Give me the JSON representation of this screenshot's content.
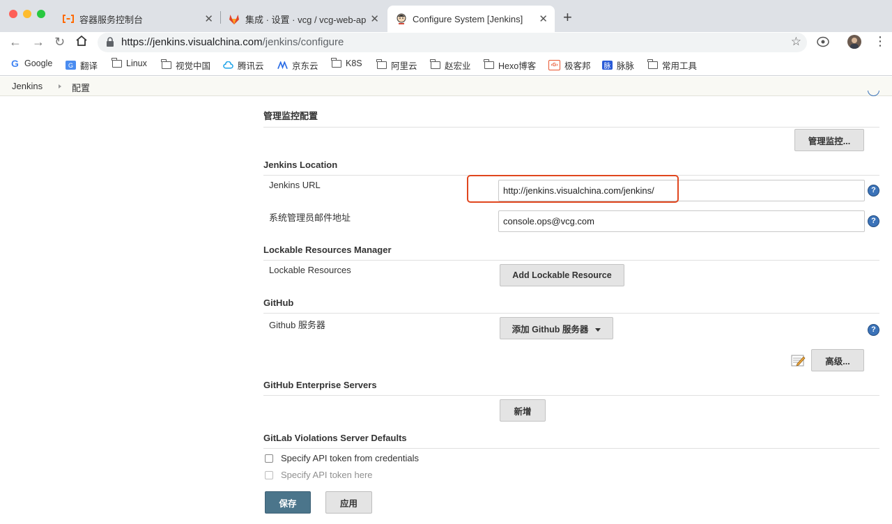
{
  "browser": {
    "tabs": [
      {
        "title": "容器服务控制台",
        "icon": "aliyun-icon"
      },
      {
        "title": "集成 · 设置 · vcg / vcg-web-ap",
        "icon": "gitlab-icon"
      },
      {
        "title": "Configure System [Jenkins]",
        "icon": "jenkins-icon",
        "active": true
      }
    ],
    "url_host": "https://jenkins.visualchina.com",
    "url_path": "/jenkins/configure",
    "bookmarks": [
      {
        "label": "Google",
        "icon": "google-icon"
      },
      {
        "label": "翻译",
        "icon": "translate-icon"
      },
      {
        "label": "Linux",
        "icon": "folder-icon"
      },
      {
        "label": "视觉中国",
        "icon": "folder-icon"
      },
      {
        "label": "腾讯云",
        "icon": "tencent-cloud-icon"
      },
      {
        "label": "京东云",
        "icon": "jd-cloud-icon"
      },
      {
        "label": "K8S",
        "icon": "folder-icon"
      },
      {
        "label": "阿里云",
        "icon": "folder-icon"
      },
      {
        "label": "赵宏业",
        "icon": "folder-icon"
      },
      {
        "label": "Hexo博客",
        "icon": "folder-icon"
      },
      {
        "label": "极客邦",
        "icon": "geekbang-icon"
      },
      {
        "label": "脉脉",
        "icon": "maimai-icon"
      },
      {
        "label": "常用工具",
        "icon": "folder-icon"
      }
    ]
  },
  "breadcrumb": {
    "root": "Jenkins",
    "current": "配置"
  },
  "sections": {
    "monitor": {
      "title": "管理监控配置",
      "button": "管理监控..."
    },
    "location": {
      "title": "Jenkins Location",
      "url_label": "Jenkins URL",
      "url_value": "http://jenkins.visualchina.com/jenkins/",
      "email_label": "系统管理员邮件地址",
      "email_value": "console.ops@vcg.com"
    },
    "lockable": {
      "title": "Lockable Resources Manager",
      "label": "Lockable Resources",
      "button": "Add Lockable Resource"
    },
    "github": {
      "title": "GitHub",
      "label": "Github 服务器",
      "button": "添加 Github 服务器",
      "advanced": "高级..."
    },
    "github_enterprise": {
      "title": "GitHub Enterprise Servers",
      "button": "新增"
    },
    "gitlab_violations": {
      "title": "GitLab Violations Server Defaults",
      "check1": "Specify API token from credentials",
      "check2": "Specify API token here"
    }
  },
  "actions": {
    "save": "保存",
    "apply": "应用"
  },
  "help_glyph": "?",
  "colors": {
    "save_button": "#4b758b",
    "highlight": "#e0461e",
    "help_icon": "#3b73b9"
  }
}
